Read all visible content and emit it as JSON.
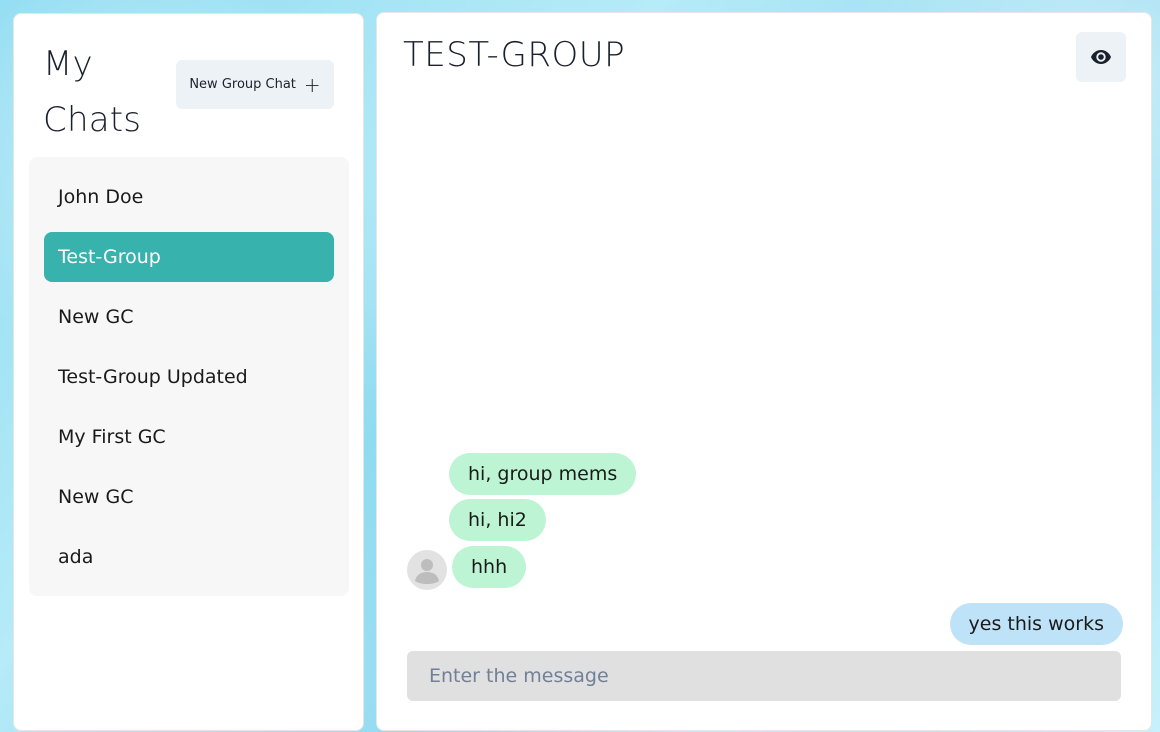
{
  "sidebar": {
    "title": "My Chats",
    "new_group_chat_label": "New Group Chat",
    "chats": [
      {
        "name": "John Doe",
        "active": false
      },
      {
        "name": "Test-Group",
        "active": true
      },
      {
        "name": "New GC",
        "active": false
      },
      {
        "name": "Test-Group Updated",
        "active": false
      },
      {
        "name": "My First GC",
        "active": false
      },
      {
        "name": "New GC",
        "active": false
      },
      {
        "name": "ada",
        "active": false
      }
    ]
  },
  "chat": {
    "title": "TEST-GROUP",
    "eye_icon": "eye-icon",
    "messages": [
      {
        "text": "hi, group mems",
        "sender": "other"
      },
      {
        "text": "hi, hi2",
        "sender": "other"
      },
      {
        "text": "hhh",
        "sender": "other"
      },
      {
        "text": "yes this works",
        "sender": "self"
      }
    ],
    "input_placeholder": "Enter the message"
  },
  "colors": {
    "active_chat": "#38b2ac",
    "incoming_bubble": "#bdf5d4",
    "outgoing_bubble": "#bee3f8"
  }
}
